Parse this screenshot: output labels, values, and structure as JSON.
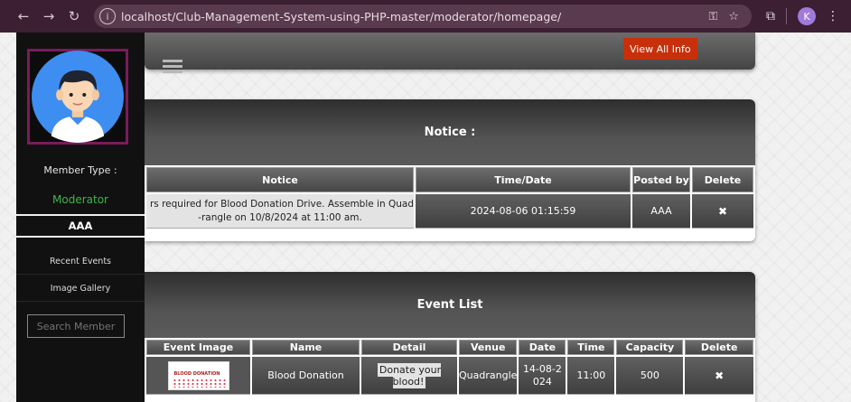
{
  "browser": {
    "url": "localhost/Club-Management-System-using-PHP-master/moderator/homepage/",
    "profile_initial": "K"
  },
  "sidebar": {
    "member_type_label": "Member Type :",
    "role": "Moderator",
    "username": "AAA",
    "menu": [
      {
        "label": "Recent Events"
      },
      {
        "label": "Image Gallery"
      }
    ],
    "search_placeholder": "Search Member"
  },
  "topbar": {
    "view_all_label": "View All Info"
  },
  "notice_panel": {
    "title": "Notice :",
    "columns": [
      "Notice",
      "Time/Date",
      "Posted by",
      "Delete"
    ],
    "rows": [
      {
        "notice_line1": "rs required for Blood Donation Drive. Assemble in Quad",
        "notice_line2": "-rangle on 10/8/2024 at 11:00 am.",
        "time_date": "2024-08-06 01:15:59",
        "posted_by": "AAA",
        "delete_icon": "✖"
      }
    ]
  },
  "event_panel": {
    "title": "Event List",
    "columns": [
      "Event Image",
      "Name",
      "Detail",
      "Venue",
      "Date",
      "Time",
      "Capacity",
      "Delete"
    ],
    "rows": [
      {
        "image_title": "BLOOD DONATION",
        "name": "Blood Donation",
        "detail": "Donate your blood!",
        "venue": "Quadrangle",
        "date": "14-08-2024",
        "time": "11:00",
        "capacity": "500",
        "delete_icon": "✖"
      }
    ]
  },
  "colors": {
    "chrome_bg": "#3c1f33",
    "sidebar_bg": "#111111",
    "role_green": "#3fb54a",
    "accent_red": "#c7300b",
    "avatar_ring": "#7d1a5b"
  }
}
